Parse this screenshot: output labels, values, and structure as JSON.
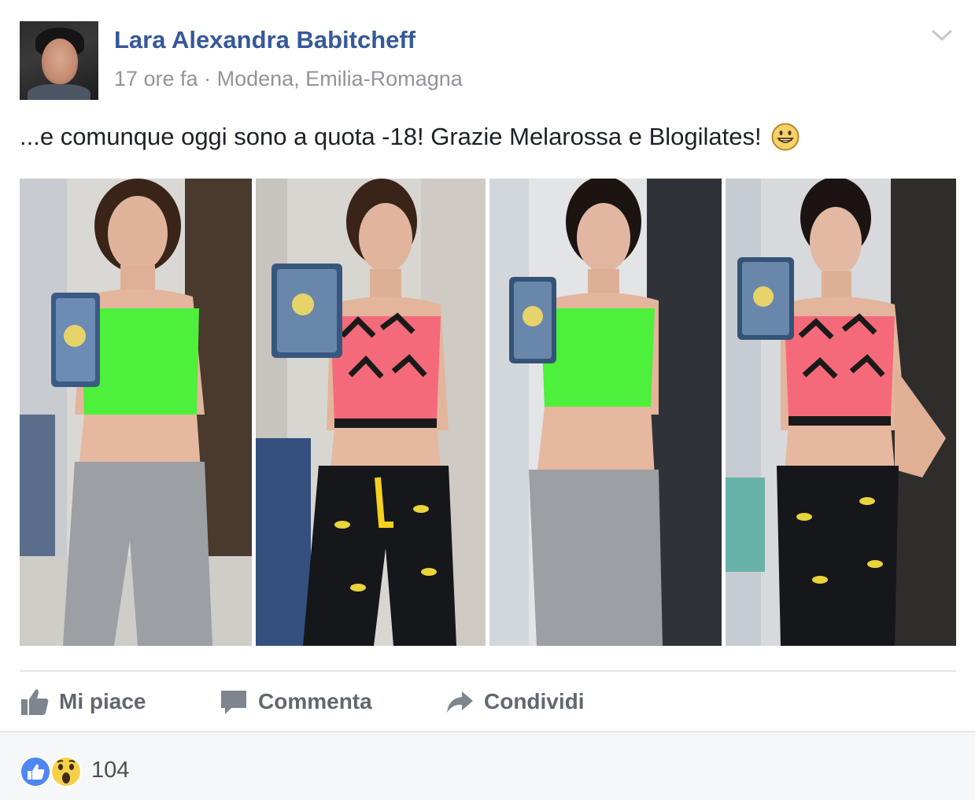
{
  "post": {
    "author": "Lara Alexandra Babitcheff",
    "time": "17 ore fa",
    "separator": "·",
    "location": "Modena, Emilia-Romagna",
    "text": "...e comunque oggi sono a quota -18! Grazie Melarossa e Blogilates!",
    "emoji_icon": "grinning-face-icon"
  },
  "photos": [
    {
      "id": "photo-1",
      "top_color": "#4df03a",
      "bottom_color": "#9c9fa3"
    },
    {
      "id": "photo-2",
      "top_color": "#f46a7a",
      "bottom_color": "#16171b"
    },
    {
      "id": "photo-3",
      "top_color": "#4df03a",
      "bottom_color": "#9c9fa3"
    },
    {
      "id": "photo-4",
      "top_color": "#f46a7a",
      "bottom_color": "#16171b"
    }
  ],
  "actions": {
    "like": "Mi piace",
    "comment": "Commenta",
    "share": "Condividi"
  },
  "reactions": {
    "count": "104",
    "icons": [
      "like-reaction-icon",
      "wow-reaction-icon"
    ]
  },
  "colors": {
    "link": "#365899",
    "meta": "#90949c",
    "action": "#616770",
    "like_blue": "#4267b2"
  }
}
